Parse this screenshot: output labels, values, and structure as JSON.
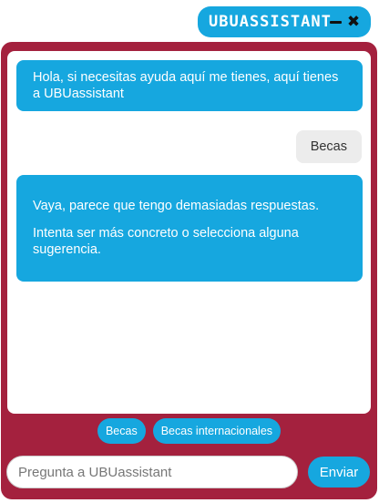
{
  "header": {
    "title": "UBUassistant",
    "minimize_icon": "minimize-icon",
    "close_icon": "close-icon",
    "accent_color": "#16a7df"
  },
  "panel": {
    "background_color": "#a4213e"
  },
  "messages": [
    {
      "sender": "bot",
      "text": "Hola, si necesitas ayuda aquí me tienes, aquí tienes a UBUassistant"
    },
    {
      "sender": "user",
      "text": "Becas"
    },
    {
      "sender": "bot",
      "paragraphs": [
        "Vaya, parece que tengo demasiadas respuestas.",
        "Intenta ser más concreto o selecciona alguna sugerencia."
      ]
    }
  ],
  "suggestions": [
    "Becas",
    "Becas internacionales"
  ],
  "composer": {
    "placeholder": "Pregunta a UBUassistant",
    "value": "",
    "send_label": "Enviar"
  }
}
